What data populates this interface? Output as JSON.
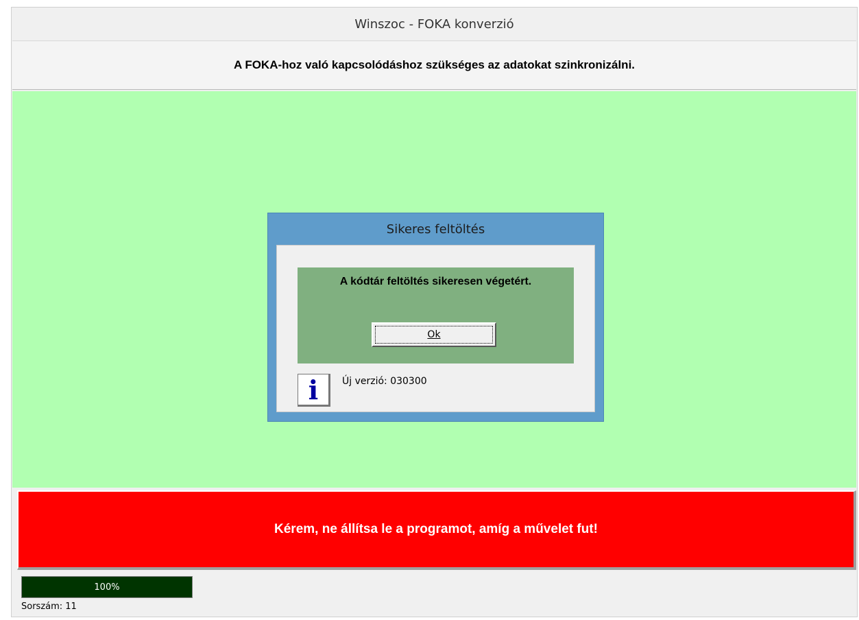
{
  "window": {
    "title": "Winszoc - FOKA konverzió"
  },
  "header": {
    "text": "A FOKA-hoz való kapcsolódáshoz szükséges az adatokat szinkronizálni."
  },
  "dialog": {
    "title": "Sikeres feltöltés",
    "message": "A kódtár feltöltés sikeresen végetért.",
    "ok_label": "Ok",
    "version_text": "Új verzió: 030300",
    "icon": "info-icon"
  },
  "warning": {
    "text": "Kérem, ne állítsa le a programot, amíg a művelet fut!"
  },
  "progress": {
    "value": 1.0,
    "label": "100%"
  },
  "status": {
    "text": "Sorszám: 11"
  },
  "colors": {
    "content_background": "#b1ffb1",
    "dialog_frame": "#5f9ccb",
    "message_panel": "#80b080",
    "warning_background": "#ff0000",
    "progress_fill": "#003400"
  }
}
